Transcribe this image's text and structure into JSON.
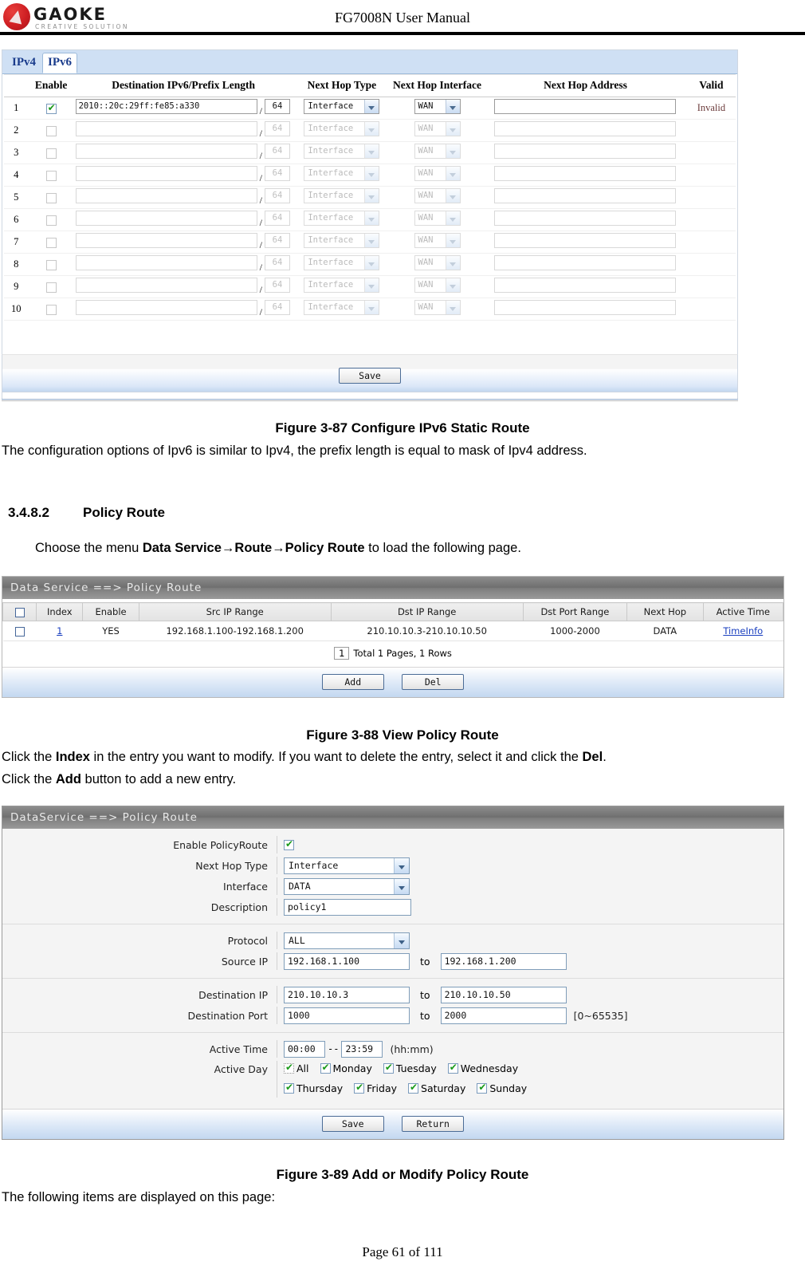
{
  "header": {
    "brand": "GAOKE",
    "brand_tagline": "CREATIVE SOLUTION",
    "title": "FG7008N User Manual"
  },
  "ipv6_route_panel": {
    "tabs": [
      {
        "label": "IPv4",
        "active": false
      },
      {
        "label": "IPv6",
        "active": true
      }
    ],
    "columns": [
      "Enable",
      "Destination IPv6/Prefix Length",
      "Next Hop Type",
      "Next Hop Interface",
      "Next Hop Address",
      "Valid"
    ],
    "rows": [
      {
        "index": "1",
        "enabled": true,
        "destination": "2010::20c:29ff:fe85:a330",
        "prefix": "64",
        "next_hop_type": "Interface",
        "next_hop_interface": "WAN",
        "next_hop_address": "",
        "valid": "Invalid"
      },
      {
        "index": "2",
        "enabled": false,
        "destination": "",
        "prefix": "64",
        "next_hop_type": "Interface",
        "next_hop_interface": "WAN",
        "next_hop_address": "",
        "valid": ""
      },
      {
        "index": "3",
        "enabled": false,
        "destination": "",
        "prefix": "64",
        "next_hop_type": "Interface",
        "next_hop_interface": "WAN",
        "next_hop_address": "",
        "valid": ""
      },
      {
        "index": "4",
        "enabled": false,
        "destination": "",
        "prefix": "64",
        "next_hop_type": "Interface",
        "next_hop_interface": "WAN",
        "next_hop_address": "",
        "valid": ""
      },
      {
        "index": "5",
        "enabled": false,
        "destination": "",
        "prefix": "64",
        "next_hop_type": "Interface",
        "next_hop_interface": "WAN",
        "next_hop_address": "",
        "valid": ""
      },
      {
        "index": "6",
        "enabled": false,
        "destination": "",
        "prefix": "64",
        "next_hop_type": "Interface",
        "next_hop_interface": "WAN",
        "next_hop_address": "",
        "valid": ""
      },
      {
        "index": "7",
        "enabled": false,
        "destination": "",
        "prefix": "64",
        "next_hop_type": "Interface",
        "next_hop_interface": "WAN",
        "next_hop_address": "",
        "valid": ""
      },
      {
        "index": "8",
        "enabled": false,
        "destination": "",
        "prefix": "64",
        "next_hop_type": "Interface",
        "next_hop_interface": "WAN",
        "next_hop_address": "",
        "valid": ""
      },
      {
        "index": "9",
        "enabled": false,
        "destination": "",
        "prefix": "64",
        "next_hop_type": "Interface",
        "next_hop_interface": "WAN",
        "next_hop_address": "",
        "valid": ""
      },
      {
        "index": "10",
        "enabled": false,
        "destination": "",
        "prefix": "64",
        "next_hop_type": "Interface",
        "next_hop_interface": "WAN",
        "next_hop_address": "",
        "valid": ""
      }
    ],
    "save_label": "Save"
  },
  "figure_87": {
    "caption": "Figure 3-87   Configure IPv6 Static Route",
    "note": "The configuration options of Ipv6 is similar to Ipv4, the prefix length is equal to mask of Ipv4 address."
  },
  "section": {
    "number": "3.4.8.2",
    "title": "Policy Route",
    "intro_prefix": "Choose the menu ",
    "intro_path": "Data Service→Route→Policy Route",
    "intro_suffix": " to load the following page."
  },
  "policy_route_list": {
    "panel_title": "Data Service ==> Policy Route",
    "columns": [
      "Index",
      "Enable",
      "Src IP Range",
      "Dst IP Range",
      "Dst Port Range",
      "Next Hop",
      "Active Time"
    ],
    "rows": [
      {
        "selected": false,
        "index": "1",
        "enable": "YES",
        "src_ip_range": "192.168.1.100-192.168.1.200",
        "dst_ip_range": "210.10.10.3-210.10.10.50",
        "dst_port_range": "1000-2000",
        "next_hop": "DATA",
        "active_time": "TimeInfo"
      }
    ],
    "pager_page": "1",
    "pager_text": "Total 1 Pages, 1 Rows",
    "add_label": "Add",
    "del_label": "Del"
  },
  "figure_88": {
    "caption": "Figure 3-88   View Policy Route",
    "note_line1_a": "Click the ",
    "note_line1_b": "Index",
    "note_line1_c": " in the entry you want to modify. If you want to delete the entry, select it and click the ",
    "note_line1_d": "Del",
    "note_line1_e": ".",
    "note_line2_a": "Click the ",
    "note_line2_b": "Add",
    "note_line2_c": " button to add a new entry."
  },
  "policy_route_form": {
    "panel_title": "DataService ==> Policy Route",
    "enable_label": "Enable PolicyRoute",
    "enable_checked": true,
    "next_hop_type_label": "Next Hop Type",
    "next_hop_type_value": "Interface",
    "interface_label": "Interface",
    "interface_value": "DATA",
    "description_label": "Description",
    "description_value": "policy1",
    "protocol_label": "Protocol",
    "protocol_value": "ALL",
    "source_ip_label": "Source IP",
    "source_ip_from": "192.168.1.100",
    "source_ip_to": "192.168.1.200",
    "destination_ip_label": "Destination IP",
    "destination_ip_from": "210.10.10.3",
    "destination_ip_to": "210.10.10.50",
    "destination_port_label": "Destination Port",
    "destination_port_from": "1000",
    "destination_port_to": "2000",
    "port_range_hint": "[0~65535]",
    "to_label": "to",
    "active_time_label": "Active Time",
    "active_time_from": "00:00",
    "active_time_sep": "--",
    "active_time_to": "23:59",
    "active_time_hint": "(hh:mm)",
    "active_day_label": "Active Day",
    "days": [
      {
        "label": "All",
        "checked": true,
        "style": "dotted"
      },
      {
        "label": "Monday",
        "checked": true,
        "style": "solid"
      },
      {
        "label": "Tuesday",
        "checked": true,
        "style": "solid"
      },
      {
        "label": "Wednesday",
        "checked": true,
        "style": "solid"
      },
      {
        "label": "Thursday",
        "checked": true,
        "style": "solid"
      },
      {
        "label": "Friday",
        "checked": true,
        "style": "solid"
      },
      {
        "label": "Saturday",
        "checked": true,
        "style": "solid"
      },
      {
        "label": "Sunday",
        "checked": true,
        "style": "solid"
      }
    ],
    "save_label": "Save",
    "return_label": "Return"
  },
  "figure_89": {
    "caption": "Figure 3-89   Add or Modify Policy Route",
    "note": "The following items are displayed on this page:"
  },
  "footer": {
    "page_text": "Page 61 of 111"
  }
}
